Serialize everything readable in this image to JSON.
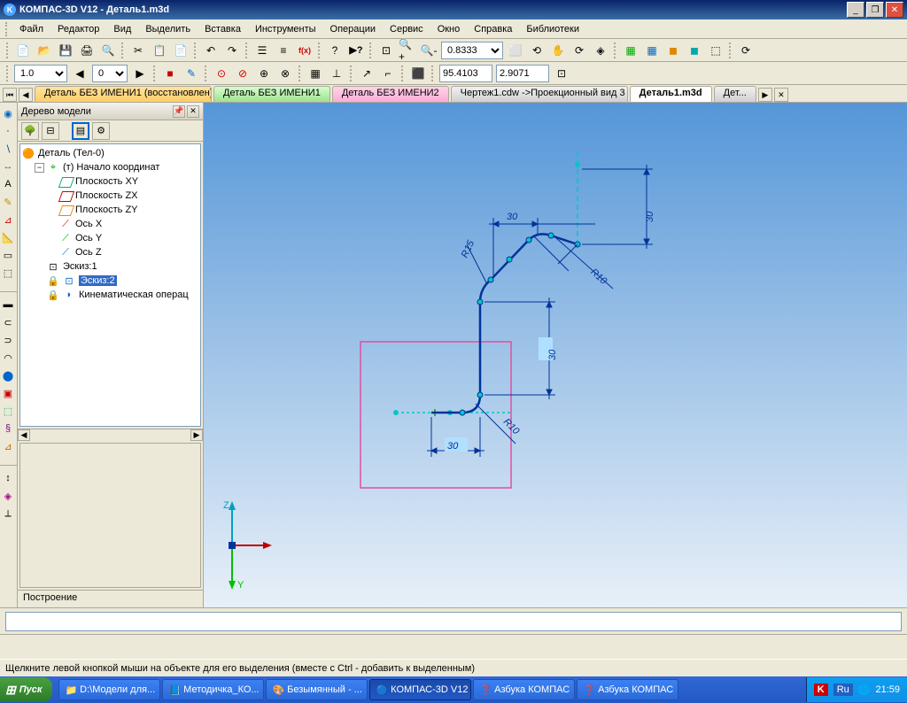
{
  "title": "КОМПАС-3D V12 - Деталь1.m3d",
  "app_icon_letter": "K",
  "menu": [
    "Файл",
    "Редактор",
    "Вид",
    "Выделить",
    "Вставка",
    "Инструменты",
    "Операции",
    "Сервис",
    "Окно",
    "Справка",
    "Библиотеки"
  ],
  "toolbar2": {
    "scale": "1.0",
    "stepval": "0",
    "coord_x": "95.4103",
    "coord_y": "2.9071",
    "zoom": "0.8333"
  },
  "tabs": [
    {
      "label": "Деталь БЕЗ ИМЕНИ1 (восстановлен)",
      "cls": "t-orange"
    },
    {
      "label": "Деталь БЕЗ ИМЕНИ1",
      "cls": "t-green"
    },
    {
      "label": "Деталь БЕЗ ИМЕНИ2",
      "cls": "t-pink"
    },
    {
      "label": "Чертеж1.cdw ->Проекционный вид 3",
      "cls": "t-gray"
    },
    {
      "label": "Деталь1.m3d",
      "cls": "t-white"
    },
    {
      "label": "Дет...",
      "cls": "t-gray"
    }
  ],
  "panel": {
    "title": "Дерево модели",
    "root": "Деталь (Тел-0)",
    "origin": "(т) Начало координат",
    "planes": [
      "Плоскость XY",
      "Плоскость ZX",
      "Плоскость ZY"
    ],
    "axes": [
      "Ось X",
      "Ось Y",
      "Ось Z"
    ],
    "sketch1": "Эскиз:1",
    "sketch2": "Эскиз:2",
    "kinematic": "Кинематическая операц",
    "bottom_tab": "Построение"
  },
  "sketch_dims": {
    "d1": "30",
    "d2": "30",
    "d3": "30",
    "d4": "30",
    "r1": "R15",
    "r2": "R10",
    "r3": "R10"
  },
  "axes_labels": {
    "z": "Z",
    "y": "Y"
  },
  "status": "Щелкните левой кнопкой мыши на объекте для его выделения (вместе с Ctrl - добавить к выделенным)",
  "taskbar": {
    "start": "Пуск",
    "items": [
      {
        "label": "D:\\Модели для...",
        "icon": "📁"
      },
      {
        "label": "Методичка_КО...",
        "icon": "📘"
      },
      {
        "label": "Безымянный - ...",
        "icon": "🎨"
      },
      {
        "label": "КОМПАС-3D V12",
        "icon": "🔵",
        "active": true
      },
      {
        "label": "Азбука КОМПАС",
        "icon": "❓"
      },
      {
        "label": "Азбука КОМПАС",
        "icon": "❓"
      }
    ],
    "tray_k": "K",
    "lang": "Ru",
    "time": "21:59"
  }
}
